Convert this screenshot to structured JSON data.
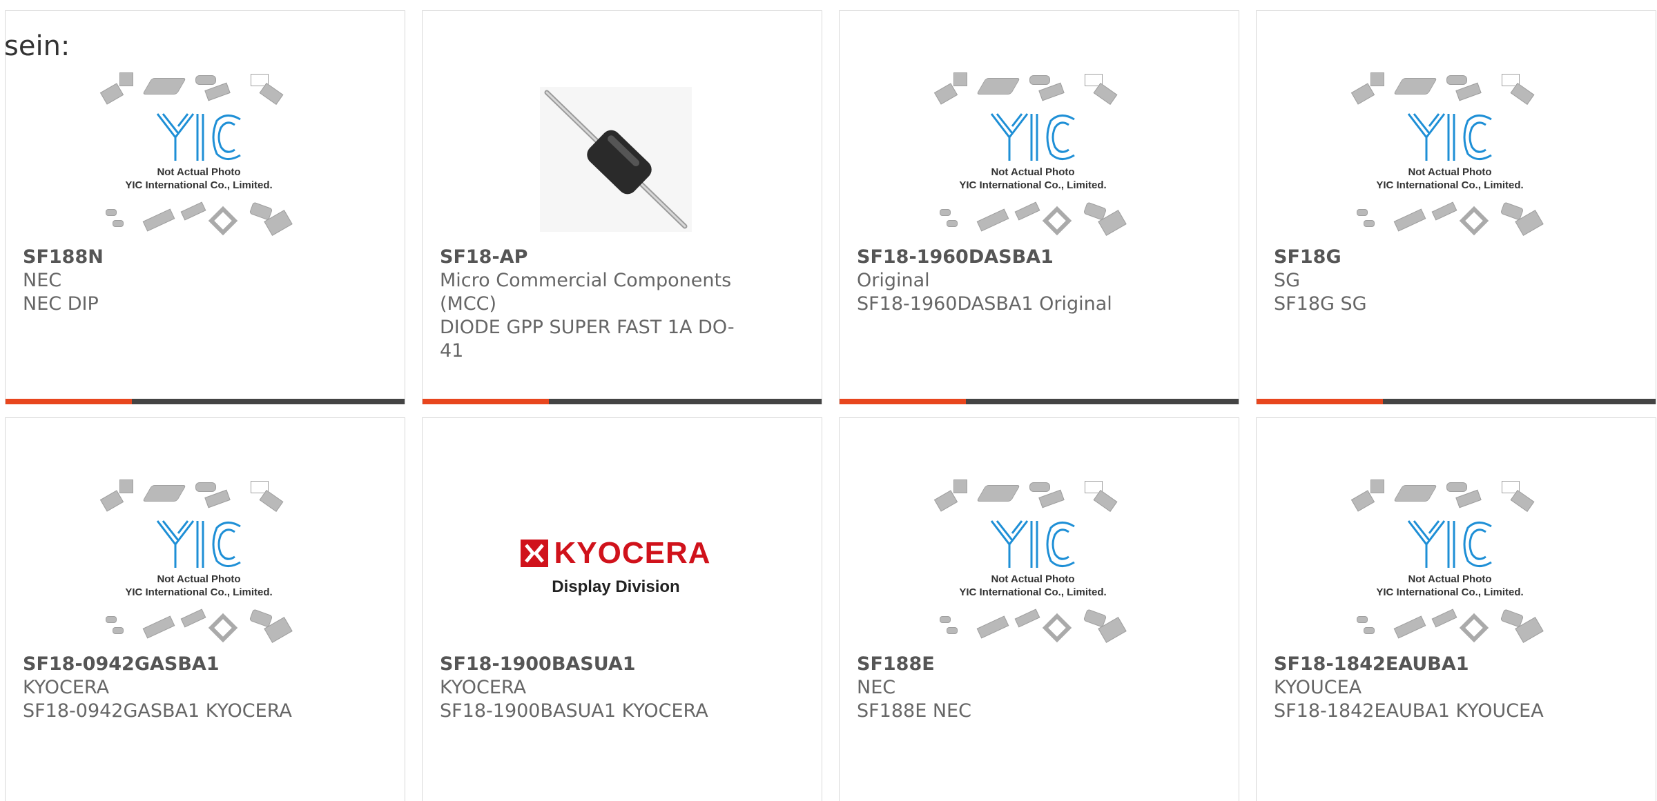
{
  "intro_text": "sein:",
  "placeholder": {
    "line1": "Not Actual Photo",
    "line2": "YIC International Co., Limited."
  },
  "brand": {
    "kyocera_name": "KYOCERA",
    "kyocera_sub": "Display Division"
  },
  "colors": {
    "accent": "#e8461e",
    "bar": "#444444",
    "logo_blue": "#1e8fd6"
  },
  "products": [
    {
      "pn": "SF188N",
      "mfr": "NEC",
      "desc": "NEC DIP",
      "image": "yic-placeholder"
    },
    {
      "pn": "SF18-AP",
      "mfr": "Micro Commercial Components (MCC)",
      "desc": "DIODE GPP SUPER FAST 1A DO-41",
      "image": "diode-photo"
    },
    {
      "pn": "SF18-1960DASBA1",
      "mfr": "Original",
      "desc": "SF18-1960DASBA1 Original",
      "image": "yic-placeholder"
    },
    {
      "pn": "SF18G",
      "mfr": "SG",
      "desc": "SF18G SG",
      "image": "yic-placeholder"
    },
    {
      "pn": "SF18-0942GASBA1",
      "mfr": "KYOCERA",
      "desc": "SF18-0942GASBA1 KYOCERA",
      "image": "yic-placeholder"
    },
    {
      "pn": "SF18-1900BASUA1",
      "mfr": "KYOCERA",
      "desc": "SF18-1900BASUA1 KYOCERA",
      "image": "kyocera-logo"
    },
    {
      "pn": "SF188E",
      "mfr": "NEC",
      "desc": "SF188E NEC",
      "image": "yic-placeholder"
    },
    {
      "pn": "SF18-1842EAUBA1",
      "mfr": "KYOUCEA",
      "desc": "SF18-1842EAUBA1 KYOUCEA",
      "image": "yic-placeholder"
    }
  ]
}
